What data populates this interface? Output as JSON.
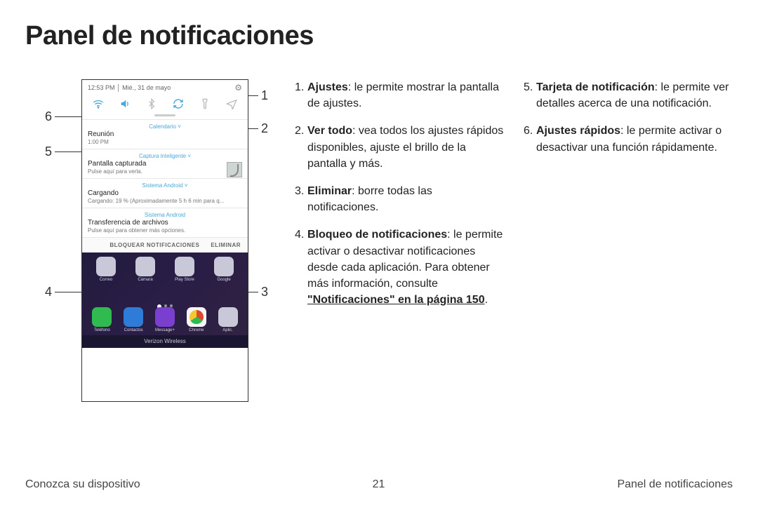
{
  "title": "Panel de notificaciones",
  "callouts": {
    "c1": "1",
    "c2": "2",
    "c3": "3",
    "c4": "4",
    "c5": "5",
    "c6": "6"
  },
  "phone": {
    "status_time": "12:53 PM",
    "status_date": "Mié., 31 de mayo",
    "gear_icon": "⚙",
    "qs_icons": {
      "wifi": "wifi-icon",
      "sound": "sound-icon",
      "bluetooth": "bluetooth-icon",
      "rotate": "rotate-icon",
      "flashlight": "flashlight-icon",
      "airplane": "airplane-icon"
    },
    "notifs": [
      {
        "app": "Calendario  ˅",
        "title": "Reunión",
        "sub": "1:00 PM"
      },
      {
        "app": "Captura inteligente  ˅",
        "title": "Pantalla capturada",
        "sub": "Pulse aquí para verla."
      },
      {
        "app": "Sistema Android  ˅",
        "title": "Cargando",
        "sub": "Cargando: 19 % (Aproximadamente 5 h 6 min para q..."
      },
      {
        "app": "Sistema Android",
        "title": "Transferencia de archivos",
        "sub": "Pulse aquí para obtener más opciones."
      }
    ],
    "action_block": "BLOQUEAR NOTIFICACIONES",
    "action_clear": "ELIMINAR",
    "home_apps_top": [
      "Correo",
      "Cámara",
      "Play Store",
      "Google"
    ],
    "home_apps_bottom": [
      "Teléfono",
      "Contactos",
      "Message+",
      "Chrome",
      "Aplic."
    ],
    "carrier": "Verizon Wireless"
  },
  "list": [
    {
      "n": "1.",
      "term": "Ajustes",
      "rest": ": le permite mostrar la pantalla de ajustes."
    },
    {
      "n": "2.",
      "term": "Ver todo",
      "rest": ": vea todos los ajustes rápidos disponibles, ajuste el brillo de la pantalla y más."
    },
    {
      "n": "3.",
      "term": "Eliminar",
      "rest": ": borre todas las notificaciones."
    },
    {
      "n": "4.",
      "term": "Bloqueo de notificaciones",
      "rest": ": le permite activar o desactivar notificaciones desde cada aplicación. Para obtener más información, consulte ",
      "link": "\"Notificaciones\" en la página 150",
      "tail": "."
    },
    {
      "n": "5.",
      "term": "Tarjeta de notificación",
      "rest": ": le permite ver detalles acerca de una notificación."
    },
    {
      "n": "6.",
      "term": "Ajustes rápidos",
      "rest": ": le permite activar o desactivar una función rápidamente."
    }
  ],
  "footer": {
    "left": "Conozca su dispositivo",
    "center": "21",
    "right": "Panel de notificaciones"
  }
}
